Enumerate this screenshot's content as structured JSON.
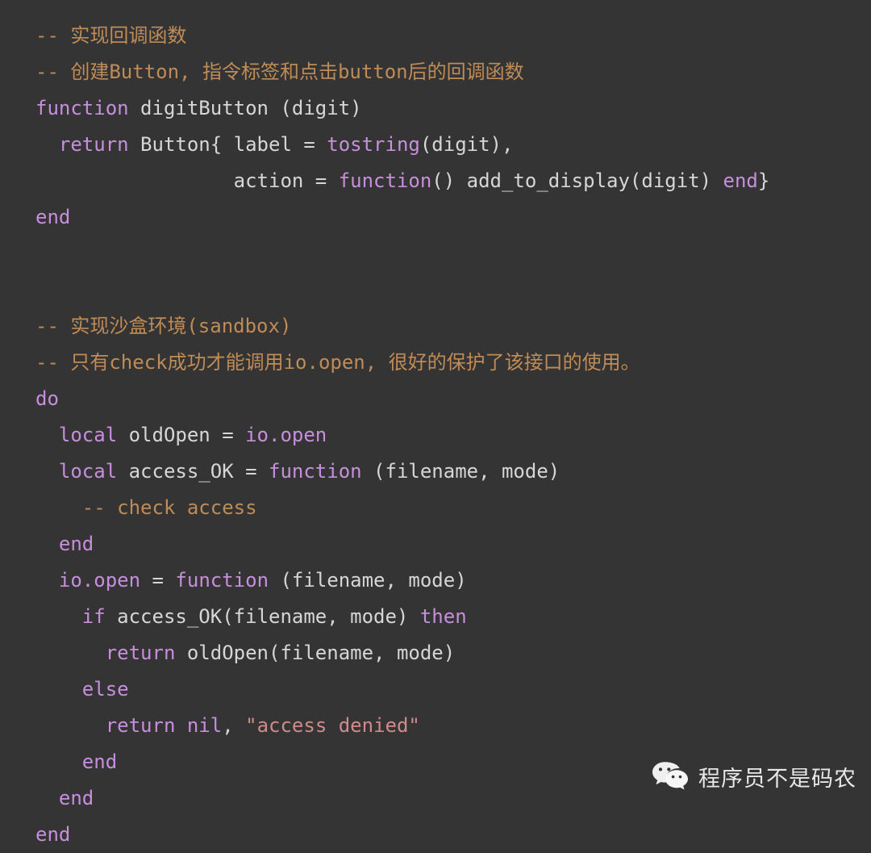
{
  "editor": {
    "language": "lua",
    "background_color": "#343434",
    "theme_colors": {
      "comment": "#bf8b56",
      "keyword": "#c78ede",
      "builtin": "#c78ede",
      "plain_text": "#d6d6d6",
      "string": "#cf8b8b"
    },
    "lines": [
      {
        "indent": 0,
        "tokens": [
          {
            "type": "comment",
            "text": "-- 实现回调函数"
          }
        ]
      },
      {
        "indent": 0,
        "tokens": [
          {
            "type": "comment",
            "text": "-- 创建Button, 指令标签和点击button后的回调函数"
          }
        ]
      },
      {
        "indent": 0,
        "tokens": [
          {
            "type": "keyword",
            "text": "function"
          },
          {
            "type": "plain",
            "text": " digitButton (digit)"
          }
        ]
      },
      {
        "indent": 2,
        "tokens": [
          {
            "type": "keyword",
            "text": "return"
          },
          {
            "type": "plain",
            "text": " Button{ label = "
          },
          {
            "type": "builtin",
            "text": "tostring"
          },
          {
            "type": "plain",
            "text": "(digit),"
          }
        ]
      },
      {
        "indent": 17,
        "tokens": [
          {
            "type": "plain",
            "text": "action = "
          },
          {
            "type": "keyword",
            "text": "function"
          },
          {
            "type": "plain",
            "text": "() add_to_display(digit) "
          },
          {
            "type": "keyword",
            "text": "end"
          },
          {
            "type": "plain",
            "text": "}"
          }
        ]
      },
      {
        "indent": 0,
        "tokens": [
          {
            "type": "keyword",
            "text": "end"
          }
        ]
      },
      {
        "indent": 0,
        "tokens": [
          {
            "type": "blank",
            "text": " "
          }
        ]
      },
      {
        "indent": 0,
        "tokens": [
          {
            "type": "blank",
            "text": " "
          }
        ]
      },
      {
        "indent": 0,
        "tokens": [
          {
            "type": "comment",
            "text": "-- 实现沙盒环境(sandbox)"
          }
        ]
      },
      {
        "indent": 0,
        "tokens": [
          {
            "type": "comment",
            "text": "-- 只有check成功才能调用io.open, 很好的保护了该接口的使用。"
          }
        ]
      },
      {
        "indent": 0,
        "tokens": [
          {
            "type": "keyword",
            "text": "do"
          }
        ]
      },
      {
        "indent": 2,
        "tokens": [
          {
            "type": "keyword",
            "text": "local"
          },
          {
            "type": "plain",
            "text": " oldOpen = "
          },
          {
            "type": "builtin",
            "text": "io.open"
          }
        ]
      },
      {
        "indent": 2,
        "tokens": [
          {
            "type": "keyword",
            "text": "local"
          },
          {
            "type": "plain",
            "text": " access_OK = "
          },
          {
            "type": "keyword",
            "text": "function"
          },
          {
            "type": "plain",
            "text": " (filename, mode)"
          }
        ]
      },
      {
        "indent": 4,
        "tokens": [
          {
            "type": "comment",
            "text": "-- check access"
          }
        ]
      },
      {
        "indent": 2,
        "tokens": [
          {
            "type": "keyword",
            "text": "end"
          }
        ]
      },
      {
        "indent": 2,
        "tokens": [
          {
            "type": "builtin",
            "text": "io.open"
          },
          {
            "type": "plain",
            "text": " = "
          },
          {
            "type": "keyword",
            "text": "function"
          },
          {
            "type": "plain",
            "text": " (filename, mode)"
          }
        ]
      },
      {
        "indent": 4,
        "tokens": [
          {
            "type": "keyword",
            "text": "if"
          },
          {
            "type": "plain",
            "text": " access_OK(filename, mode) "
          },
          {
            "type": "keyword",
            "text": "then"
          }
        ]
      },
      {
        "indent": 6,
        "tokens": [
          {
            "type": "keyword",
            "text": "return"
          },
          {
            "type": "plain",
            "text": " oldOpen(filename, mode)"
          }
        ]
      },
      {
        "indent": 4,
        "tokens": [
          {
            "type": "keyword",
            "text": "else"
          }
        ]
      },
      {
        "indent": 6,
        "tokens": [
          {
            "type": "keyword",
            "text": "return"
          },
          {
            "type": "plain",
            "text": " "
          },
          {
            "type": "keyword",
            "text": "nil"
          },
          {
            "type": "plain",
            "text": ", "
          },
          {
            "type": "string",
            "text": "\"access denied\""
          }
        ]
      },
      {
        "indent": 4,
        "tokens": [
          {
            "type": "keyword",
            "text": "end"
          }
        ]
      },
      {
        "indent": 2,
        "tokens": [
          {
            "type": "keyword",
            "text": "end"
          }
        ]
      },
      {
        "indent": 0,
        "tokens": [
          {
            "type": "keyword",
            "text": "end"
          }
        ]
      }
    ]
  },
  "watermark": {
    "icon": "wechat-logo-icon",
    "account_name": "程序员不是码农",
    "text_color": "#e8e8e8"
  }
}
